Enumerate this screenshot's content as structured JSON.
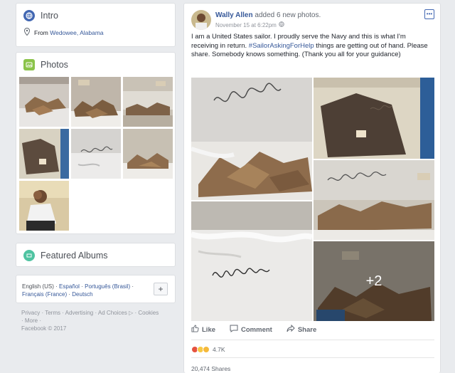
{
  "intro": {
    "title": "Intro",
    "from_prefix": "From",
    "from_place": "Wedowee, Alabama"
  },
  "photos": {
    "title": "Photos",
    "thumbs": [
      "cardboard-pile-photo",
      "cardboard-mess-photo",
      "bunk-debris-photo",
      "blanket-photo",
      "scribble-sheet-photo",
      "cardboard-floor-photo",
      "sailor-portrait-photo"
    ]
  },
  "albums": {
    "title": "Featured Albums"
  },
  "languages": {
    "current": "English (US)",
    "sep": "·",
    "others": [
      "Español",
      "Português (Brasil)",
      "Français (France)",
      "Deutsch"
    ],
    "add_label": "+"
  },
  "footer": {
    "links": [
      "Privacy",
      "Terms",
      "Advertising",
      "Ad Choices",
      "Cookies",
      "More"
    ],
    "copyright": "Facebook © 2017"
  },
  "post": {
    "author": "Wally Allen",
    "action": "added 6 new photos.",
    "timestamp": "November 15 at 6:22pm",
    "text_before": "I am a United States sailor. I proudly serve the Navy and this is what I'm receiving in return. ",
    "hashtag": "#SailorAskingForHelp",
    "text_after": " things are getting out of hand. Please share. Somebody knows something. (Thank you all for your guidance)",
    "more_count": "+2",
    "actions": {
      "like": "Like",
      "comment": "Comment",
      "share": "Share"
    },
    "reaction_count": "4.7K",
    "shares": "20,474 Shares"
  },
  "colors": {
    "link": "#365899",
    "bg": "#e9ebee",
    "intro_icon": "#4267b2",
    "photos_icon": "#8bc34a",
    "albums_icon": "#4fc3a1"
  }
}
